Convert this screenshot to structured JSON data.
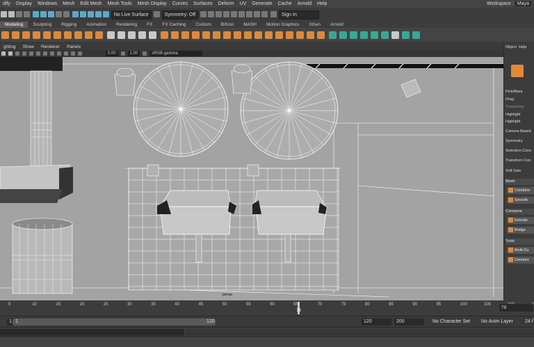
{
  "menubar": {
    "items": [
      "dify",
      "Display",
      "Windows",
      "Mesh",
      "Edit Mesh",
      "Mesh Tools",
      "Mesh Display",
      "Curves",
      "Surfaces",
      "Deform",
      "UV",
      "Generate",
      "Cache",
      "Arnold",
      "Help"
    ],
    "workspace_label": "Workspace :",
    "workspace_value": "Maya"
  },
  "statusline": {
    "live_surface": "No Live Surface",
    "symmetry": "Symmetry: Off",
    "sign_in": "Sign In"
  },
  "shelf": {
    "active_mode": "Modeling",
    "tabs": [
      "Sculpting",
      "Rigging",
      "Animation",
      "Rendering",
      "FX",
      "FX Caching",
      "Custom",
      "Bifrost",
      "MASH",
      "Motion Graphics",
      "XGen",
      "Arnold"
    ]
  },
  "panel": {
    "menus": [
      "ghting",
      "Show",
      "Renderer",
      "Panels"
    ],
    "field_a": "0.00",
    "field_b": "1.00",
    "color_space": "sRGB gamma",
    "camera": "persp"
  },
  "right_panel": {
    "tabs": [
      "Object",
      "Help"
    ],
    "pick_marquee": "Pick/Marq",
    "drag": "Drag",
    "tweak": "Tweak/Mar",
    "highlight1": "Highlight",
    "highlight2": "Highlight",
    "camera_based": "Camera Based",
    "symmetry": "Symmetry",
    "selection_const": "Selection Cons",
    "transform_const": "Transform Con",
    "soft_select": "Soft Sele",
    "mesh_header": "Mesh",
    "combine": "Combine",
    "smooth": "Smooth",
    "components_header": "Compone",
    "extrude": "Extrude",
    "bridge": "Bridge",
    "tools_header": "Tools",
    "multicut": "Multi-Cu",
    "connect": "Connect"
  },
  "timeslider": {
    "ticks": [
      "5",
      "10",
      "15",
      "20",
      "25",
      "30",
      "35",
      "40",
      "45",
      "50",
      "55",
      "60",
      "65",
      "70",
      "75",
      "80",
      "85",
      "90",
      "95",
      "100",
      "105",
      "110",
      "115",
      "120"
    ],
    "current_frame": "78",
    "marker_label": "78"
  },
  "range": {
    "start": "1",
    "inner_start": "1",
    "inner_end": "120",
    "end": "120",
    "max_end": "200",
    "character_set": "No Character Set",
    "anim_layer": "No Anim Layer",
    "fps": "24 f"
  }
}
